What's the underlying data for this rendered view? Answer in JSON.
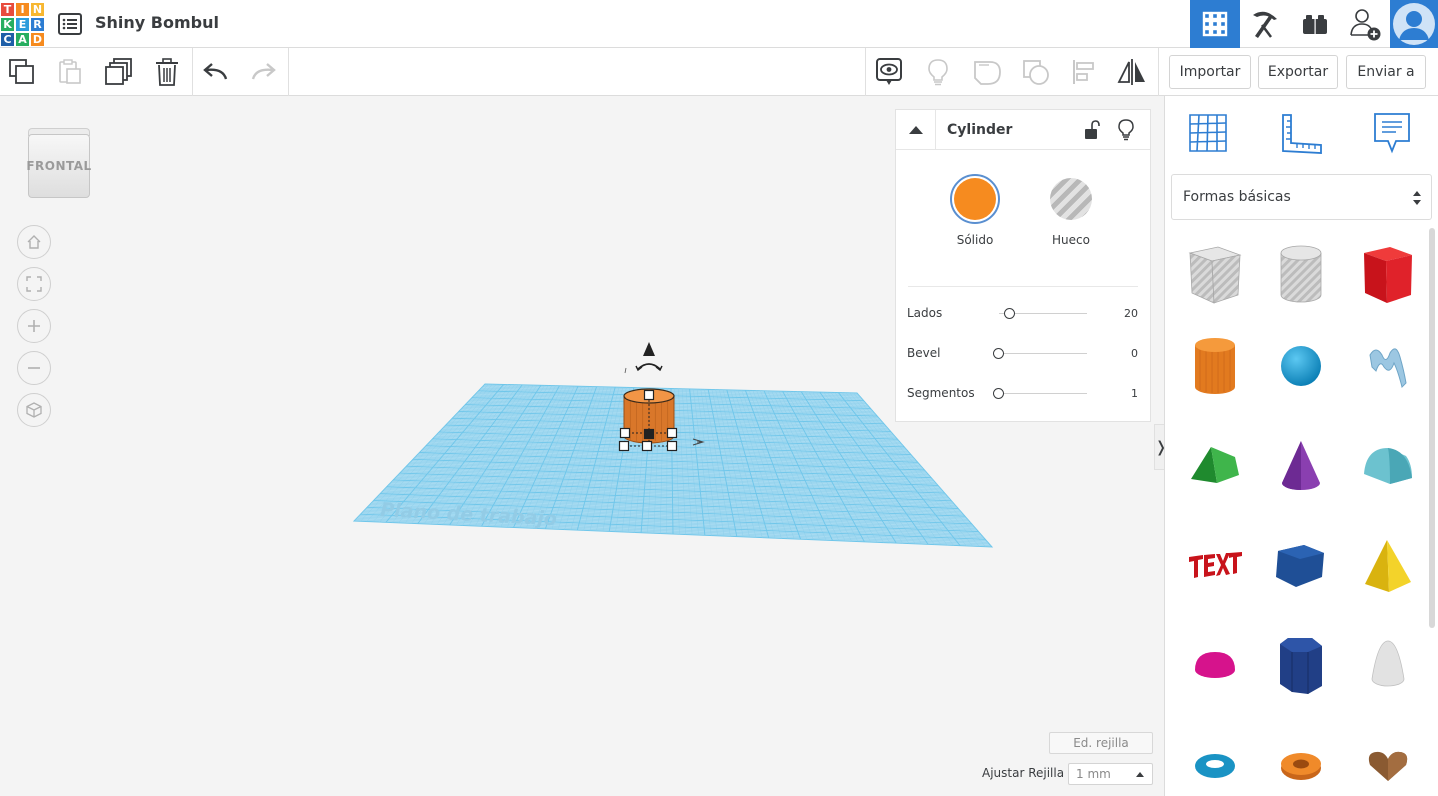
{
  "header": {
    "logo_letters": [
      "T",
      "I",
      "N",
      "K",
      "E",
      "R",
      "C",
      "A",
      "D"
    ],
    "logo_colors": [
      "#e84c3d",
      "#f68b1f",
      "#f7b731",
      "#27ae60",
      "#2d9cdb",
      "#2d7dd2",
      "#1f5fa8",
      "#27ae60",
      "#f68b1f"
    ],
    "title": "Shiny Bombul",
    "icons": [
      "list-icon",
      "grid-view-icon",
      "pickaxe-icon",
      "lego-bricks-icon",
      "add-user-icon",
      "user-avatar-icon"
    ]
  },
  "toolbar": {
    "icons": [
      "copy-icon",
      "paste-icon",
      "duplicate-icon",
      "delete-icon",
      "undo-icon",
      "redo-icon",
      "view-notes-icon",
      "light-bulb-icon",
      "shape-group-icon",
      "shape-ungroup-icon",
      "align-icon",
      "mirror-icon"
    ],
    "import_label": "Importar",
    "export_label": "Exportar",
    "send_label": "Enviar a"
  },
  "workspace": {
    "viewcube_label": "FRONTAL",
    "nav_icons": [
      "home-icon",
      "fit-view-icon",
      "zoom-in-icon",
      "zoom-out-icon",
      "orthographic-icon"
    ],
    "workplane_label": "Plano de trabajo",
    "edit_grid_label": "Ed. rejilla",
    "snap_grid_label": "Ajustar Rejilla",
    "snap_grid_value": "1 mm",
    "grid_color": "#6fc6ea",
    "object_color": "#d9772a"
  },
  "inspector": {
    "shape_name": "Cylinder",
    "solid_label": "Sólido",
    "hole_label": "Hueco",
    "solid_color": "#f68b1f",
    "props": [
      {
        "label": "Lados",
        "value": "20",
        "level": 0.12
      },
      {
        "label": "Bevel",
        "value": "0",
        "level": 0
      },
      {
        "label": "Segmentos",
        "value": "1",
        "level": 0
      }
    ]
  },
  "panel_toggle_glyph": "❭",
  "shapes_panel": {
    "tool_icons": [
      "workplane-icon",
      "ruler-icon",
      "notes-icon"
    ],
    "category": "Formas básicas",
    "shapes": [
      "box-hole",
      "cylinder-hole",
      "box",
      "cylinder",
      "sphere",
      "scribble",
      "roof",
      "cone",
      "round-roof",
      "text",
      "polygon",
      "pyramid",
      "half-sphere",
      "hexagonal-prism",
      "paraboloid",
      "torus",
      "tube",
      "heart"
    ]
  }
}
